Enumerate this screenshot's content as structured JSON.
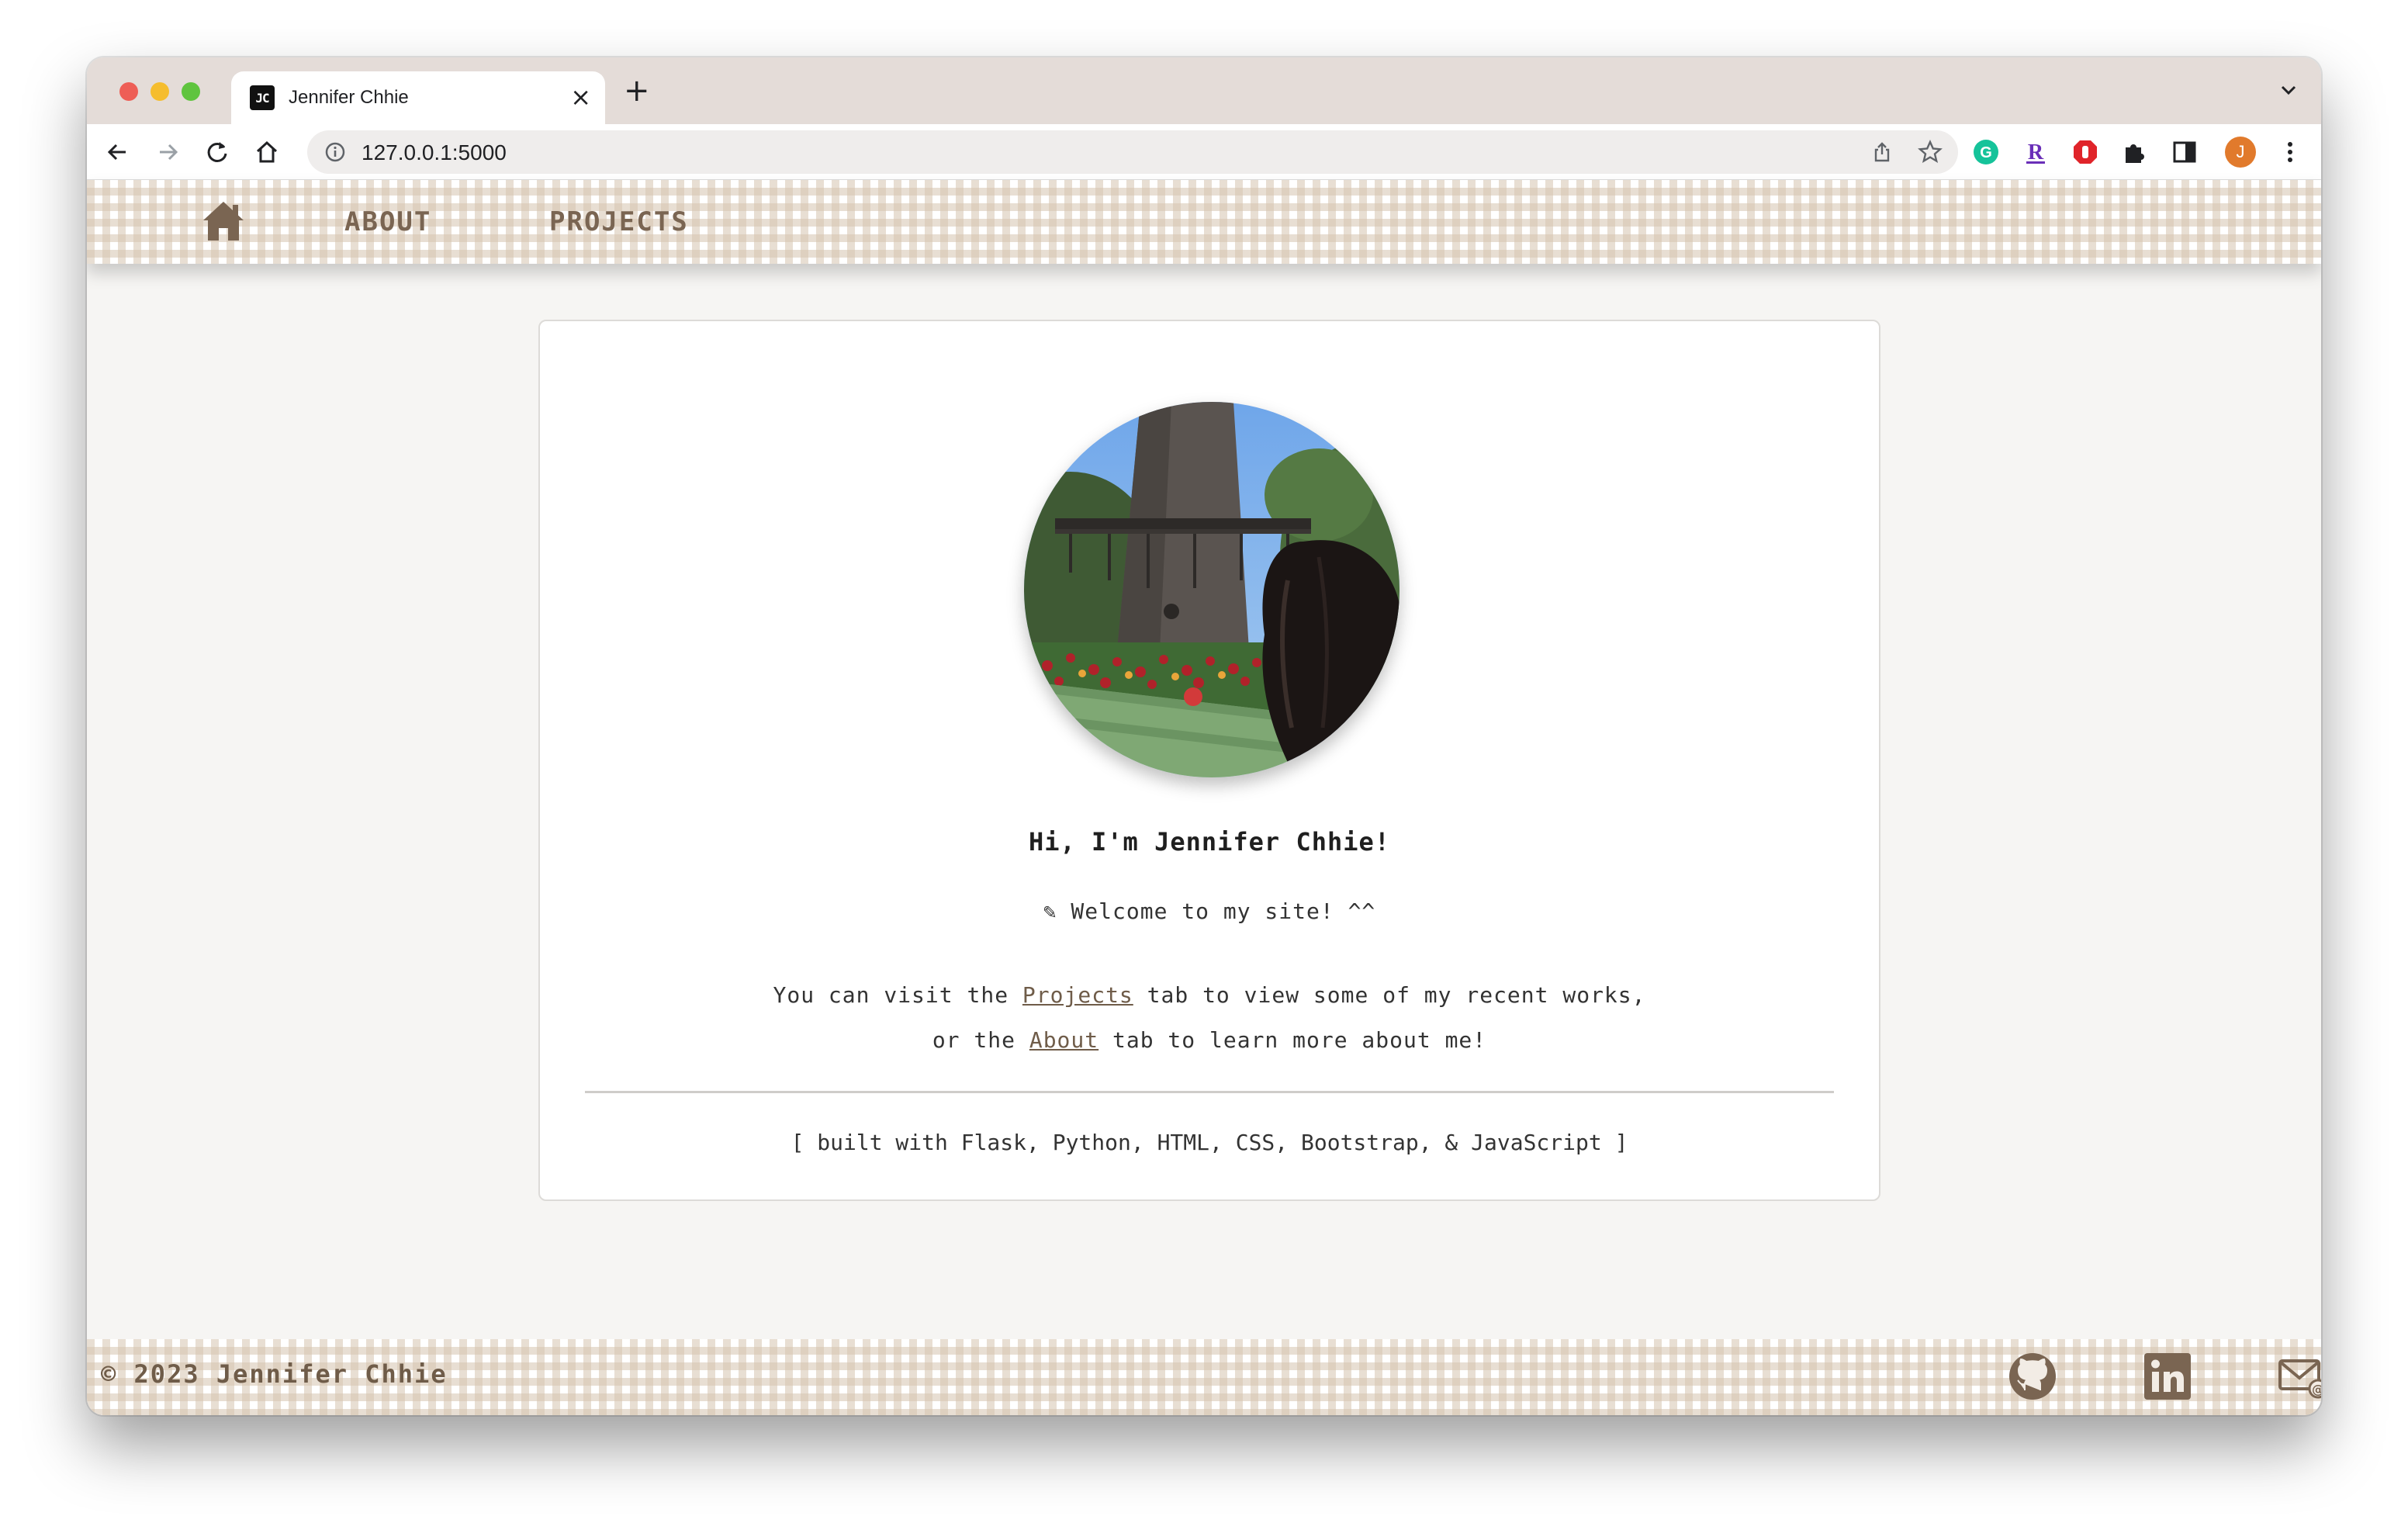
{
  "browser": {
    "tab_title": "Jennifer Chhie",
    "tab_favicon_text": "JC",
    "url": "127.0.0.1:5000",
    "profile_initial": "J"
  },
  "nav": {
    "home_icon": "home-icon",
    "items": [
      {
        "label": "ABOUT"
      },
      {
        "label": "PROJECTS"
      }
    ]
  },
  "card": {
    "greeting": "Hi, I'm Jennifer Chhie!",
    "welcome": "✎ Welcome to my site! ^^",
    "line1_pre": "You can visit the ",
    "line1_link": "Projects",
    "line1_post": " tab to view some of my recent works,",
    "line2_pre": "or the ",
    "line2_link": "About",
    "line2_post": " tab to learn more about me!",
    "built_with": "[ built with Flask, Python, HTML, CSS, Bootstrap, & JavaScript ]"
  },
  "footer": {
    "copyright": "© 2023 Jennifer Chhie",
    "icons": [
      "github-icon",
      "linkedin-icon",
      "email-icon"
    ]
  },
  "colors": {
    "accent_brown": "#7a6552",
    "gingham_tan": "#d6c4af",
    "page_bg": "#f6f5f3"
  }
}
